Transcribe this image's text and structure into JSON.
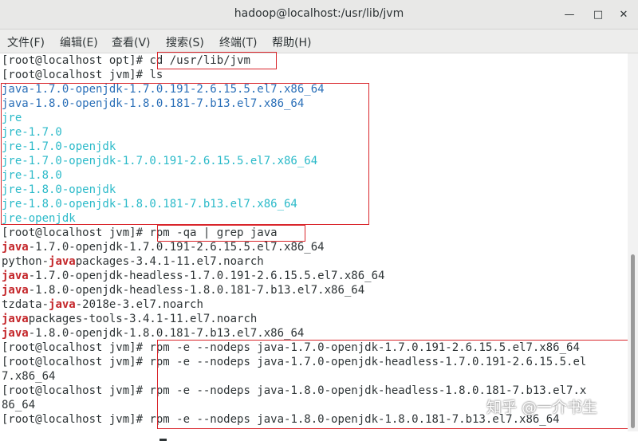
{
  "window": {
    "title": "hadoop@localhost:/usr/lib/jvm",
    "minimize_glyph": "—",
    "maximize_glyph": "□",
    "close_glyph": "✕"
  },
  "menu": [
    "文件(F)",
    "编辑(E)",
    "查看(V)",
    "搜索(S)",
    "终端(T)",
    "帮助(H)"
  ],
  "terminal": {
    "prompt_opt": "[root@localhost opt]# ",
    "prompt_jvm": "[root@localhost jvm]# ",
    "cmd_cd": "cd /usr/lib/jvm",
    "cmd_ls": "ls",
    "ls_output": [
      {
        "text": "java-1.7.0-openjdk-1.7.0.191-2.6.15.5.el7.x86_64",
        "color": "blue"
      },
      {
        "text": "java-1.8.0-openjdk-1.8.0.181-7.b13.el7.x86_64",
        "color": "blue"
      },
      {
        "text": "jre",
        "color": "cyan"
      },
      {
        "text": "jre-1.7.0",
        "color": "cyan"
      },
      {
        "text": "jre-1.7.0-openjdk",
        "color": "cyan"
      },
      {
        "text": "jre-1.7.0-openjdk-1.7.0.191-2.6.15.5.el7.x86_64",
        "color": "cyan"
      },
      {
        "text": "jre-1.8.0",
        "color": "cyan"
      },
      {
        "text": "jre-1.8.0-openjdk",
        "color": "cyan"
      },
      {
        "text": "jre-1.8.0-openjdk-1.8.0.181-7.b13.el7.x86_64",
        "color": "cyan"
      },
      {
        "text": "jre-openjdk",
        "color": "cyan"
      }
    ],
    "cmd_rpm_query": "rpm -qa | grep java",
    "rpm_output": [
      {
        "pre": "",
        "match": "java",
        "post": "-1.7.0-openjdk-1.7.0.191-2.6.15.5.el7.x86_64"
      },
      {
        "pre": "python-",
        "match": "java",
        "post": "packages-3.4.1-11.el7.noarch"
      },
      {
        "pre": "",
        "match": "java",
        "post": "-1.7.0-openjdk-headless-1.7.0.191-2.6.15.5.el7.x86_64"
      },
      {
        "pre": "",
        "match": "java",
        "post": "-1.8.0-openjdk-headless-1.8.0.181-7.b13.el7.x86_64"
      },
      {
        "pre": "tzdata-",
        "match": "java",
        "post": "-2018e-3.el7.noarch"
      },
      {
        "pre": "",
        "match": "java",
        "post": "packages-tools-3.4.1-11.el7.noarch"
      },
      {
        "pre": "",
        "match": "java",
        "post": "-1.8.0-openjdk-1.8.0.181-7.b13.el7.x86_64"
      }
    ],
    "rpm_remove": {
      "cmd1": "rpm -e --nodeps java-1.7.0-openjdk-1.7.0.191-2.6.15.5.el7.x86_64",
      "cmd2": "rpm -e --nodeps java-1.7.0-openjdk-headless-1.7.0.191-2.6.15.5.el",
      "cmd2_wrap": "7.x86_64",
      "cmd3": "rpm -e --nodeps java-1.8.0-openjdk-headless-1.8.0.181-7.b13.el7.x",
      "cmd3_wrap": "86_64",
      "cmd4": "rpm -e --nodeps java-1.8.0-openjdk-1.8.0.181-7.b13.el7.x86_64"
    }
  },
  "watermark": "知乎 @一介书生",
  "colors": {
    "ls_dir_blue": "#2a6fb8",
    "ls_link_cyan": "#2bbac9",
    "grep_match_red": "#c4262a",
    "annotation_box_red": "#d9252b"
  }
}
